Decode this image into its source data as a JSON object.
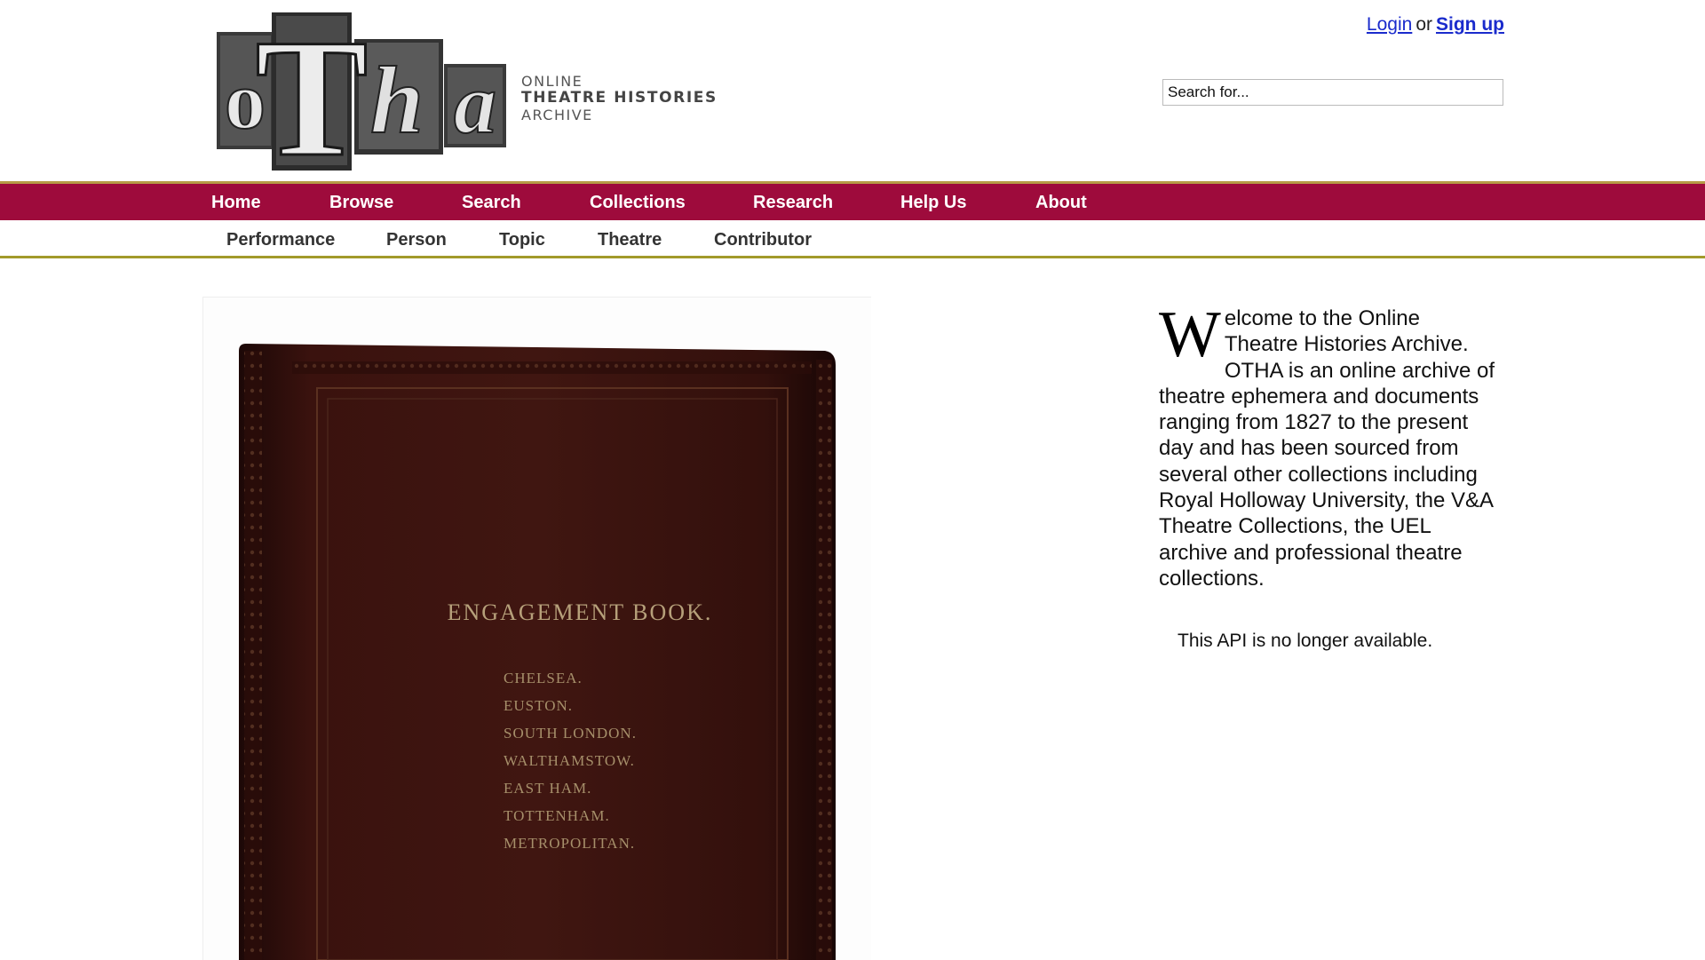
{
  "brand": {
    "logo_letters": [
      "o",
      "T",
      "h",
      "a"
    ],
    "logo_line1": "ONLINE",
    "logo_line2": "THEATRE HISTORIES",
    "logo_line3": "ARCHIVE"
  },
  "auth": {
    "login": "Login",
    "or": "or",
    "signup": "Sign up"
  },
  "search": {
    "placeholder": "Search for..."
  },
  "main_nav": [
    {
      "label": "Home"
    },
    {
      "label": "Browse"
    },
    {
      "label": "Search"
    },
    {
      "label": "Collections"
    },
    {
      "label": "Research"
    },
    {
      "label": "Help Us"
    },
    {
      "label": "About"
    }
  ],
  "sub_nav": [
    {
      "label": "Performance"
    },
    {
      "label": "Person"
    },
    {
      "label": "Topic"
    },
    {
      "label": "Theatre"
    },
    {
      "label": "Contributor"
    }
  ],
  "hero": {
    "book_title": "ENGAGEMENT BOOK.",
    "book_lines": [
      "CHELSEA.",
      "EUSTON.",
      "SOUTH LONDON.",
      "WALTHAMSTOW.",
      "EAST HAM.",
      "TOTTENHAM.",
      "METROPOLITAN."
    ]
  },
  "welcome": {
    "dropcap": "W",
    "text": "elcome to the Online Theatre Histories Archive. OTHA is an online archive of theatre ephemera and documents ranging from 1827 to the present day and has been sourced from several other collections including Royal Holloway University, the V&A Theatre Collections, the UEL archive and professional theatre collections."
  },
  "api_note": "This API is no longer available.",
  "colors": {
    "nav_bg": "#9e0b3c",
    "nav_top_border": "#b79b46",
    "subnav_border": "#a29a2a",
    "link": "#1a2bcc",
    "book_leather": "#3a120e",
    "book_gold": "#b6a07a"
  }
}
